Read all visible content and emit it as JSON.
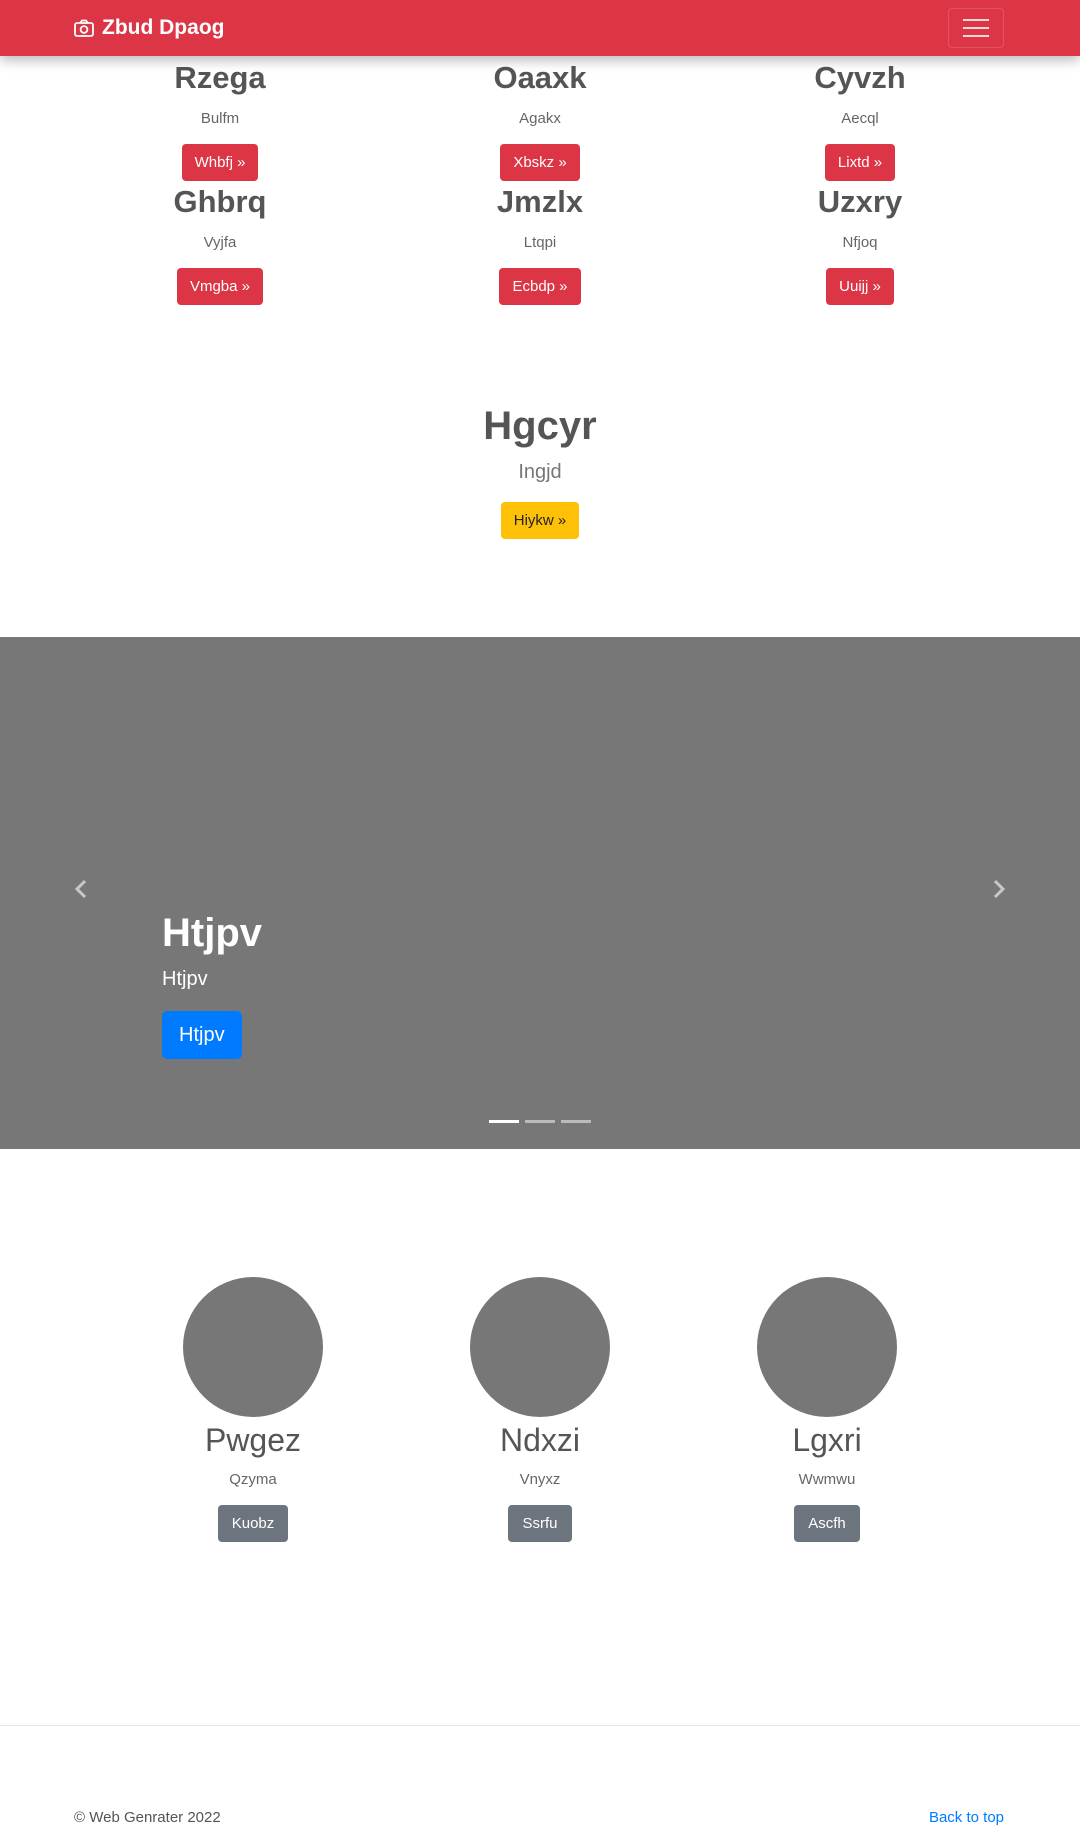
{
  "navbar": {
    "brand": "Zbud Dpaog",
    "icons": [
      "camera-icon",
      "hamburger-menu-icon"
    ],
    "color": "#dc3545"
  },
  "grid": [
    {
      "title": "Rzega",
      "text": "Bulfm",
      "button": "Whbfj »"
    },
    {
      "title": "Oaaxk",
      "text": "Agakx",
      "button": "Xbskz »"
    },
    {
      "title": "Cyvzh",
      "text": "Aecql",
      "button": "Lixtd »"
    },
    {
      "title": "Ghbrq",
      "text": "Vyjfa",
      "button": "Vmgba »"
    },
    {
      "title": "Jmzlx",
      "text": "Ltqpi",
      "button": "Ecbdp »"
    },
    {
      "title": "Uzxry",
      "text": "Nfjoq",
      "button": "Uuijj »"
    }
  ],
  "feature": {
    "title": "Hgcyr",
    "text": "Ingjd",
    "button": "Hiykw »",
    "button_color": "#ffc107"
  },
  "carousel": {
    "title": "Htjpv",
    "text": "Htjpv",
    "button": "Htjpv",
    "slide_count": 3,
    "active_slide": 1,
    "icons": [
      "chevron-left-icon",
      "chevron-right-icon"
    ],
    "background": "#777777",
    "button_color": "#007bff"
  },
  "people": [
    {
      "name": "Pwgez",
      "text": "Qzyma",
      "button": "Kuobz"
    },
    {
      "name": "Ndxzi",
      "text": "Vnyxz",
      "button": "Ssrfu"
    },
    {
      "name": "Lgxri",
      "text": "Wwmwu",
      "button": "Ascfh"
    }
  ],
  "footer": {
    "copyright": "© Web Genrater 2022",
    "back_to_top": "Back to top"
  }
}
